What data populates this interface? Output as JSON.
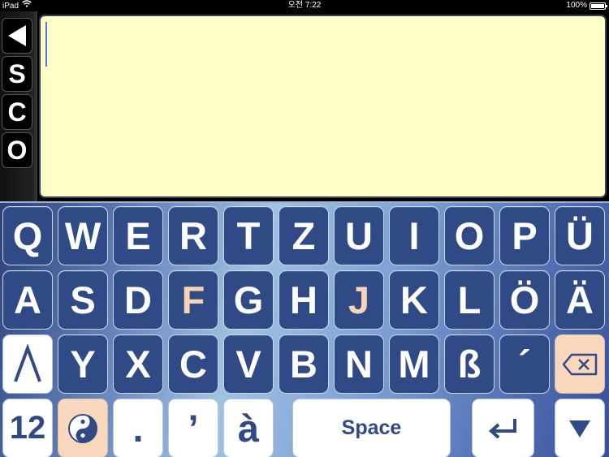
{
  "status_bar": {
    "device": "iPad",
    "time": "오전 7:22",
    "battery": "100%"
  },
  "sidebar": {
    "buttons": [
      {
        "name": "back",
        "label": "◀"
      },
      {
        "name": "s",
        "label": "S"
      },
      {
        "name": "c",
        "label": "C"
      },
      {
        "name": "o",
        "label": "O"
      }
    ]
  },
  "text_area": {
    "value": ""
  },
  "keyboard": {
    "rows": [
      [
        "Q",
        "W",
        "E",
        "R",
        "T",
        "Z",
        "U",
        "I",
        "O",
        "P",
        "Ü"
      ],
      [
        "A",
        "S",
        "D",
        "F",
        "G",
        "H",
        "J",
        "K",
        "L",
        "Ö",
        "Ä"
      ],
      [
        "⋀",
        "Y",
        "X",
        "C",
        "V",
        "B",
        "N",
        "M",
        "ß",
        "´",
        "⌫"
      ],
      [
        "12",
        "☯",
        ".",
        "’",
        "à",
        "Space",
        "↵",
        "▼"
      ]
    ]
  },
  "colors": {
    "key_blue": "#2f4a85",
    "text_area_bg": "#ffffc8",
    "home_key_letter": "#f7d4b8",
    "peach_key_bg": "#f8d7bd"
  }
}
